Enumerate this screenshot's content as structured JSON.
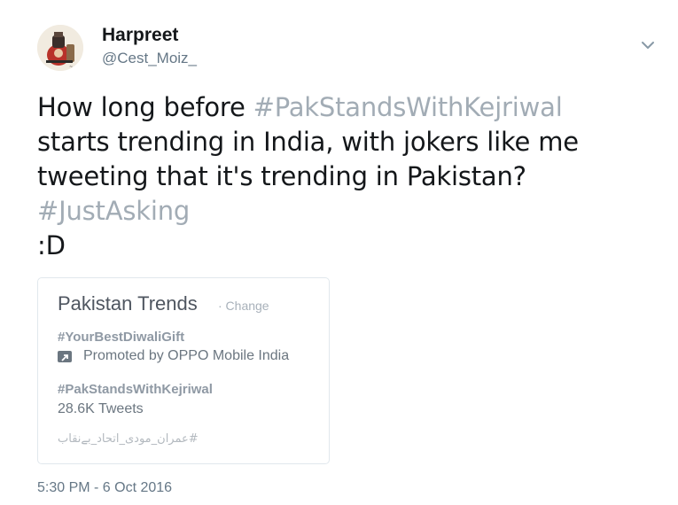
{
  "tweet": {
    "author": {
      "display_name": "Harpreet",
      "handle": "@Cest_Moiz_",
      "avatar_icon": "avatar-illustration"
    },
    "menu_icon": "chevron-down-icon",
    "text": {
      "line1_prefix": "How long before ",
      "line1_hashtag": "#PakStandsWithKejriwal",
      "line2": "starts trending in India, with jokers like me",
      "line3": "tweeting that it's trending in Pakistan?",
      "line4_hashtag": "#JustAsking",
      "line5": ":D"
    },
    "timestamp": "5:30 PM - 6 Oct 2016"
  },
  "embedded_image": {
    "title": "Pakistan Trends",
    "change_label": "· Change",
    "trends": [
      {
        "tag": "#YourBestDiwaliGift",
        "meta": "Promoted by OPPO Mobile India"
      },
      {
        "tag": "#PakStandsWithKejriwal",
        "meta": "28.6K Tweets"
      },
      {
        "tag": "#عمران_مودی_اتحاد_بےنقاب"
      }
    ]
  },
  "colors": {
    "text": "#14171a",
    "secondary": "#657786",
    "hashtag": "#a2acb5",
    "border": "#e1e8ed"
  }
}
